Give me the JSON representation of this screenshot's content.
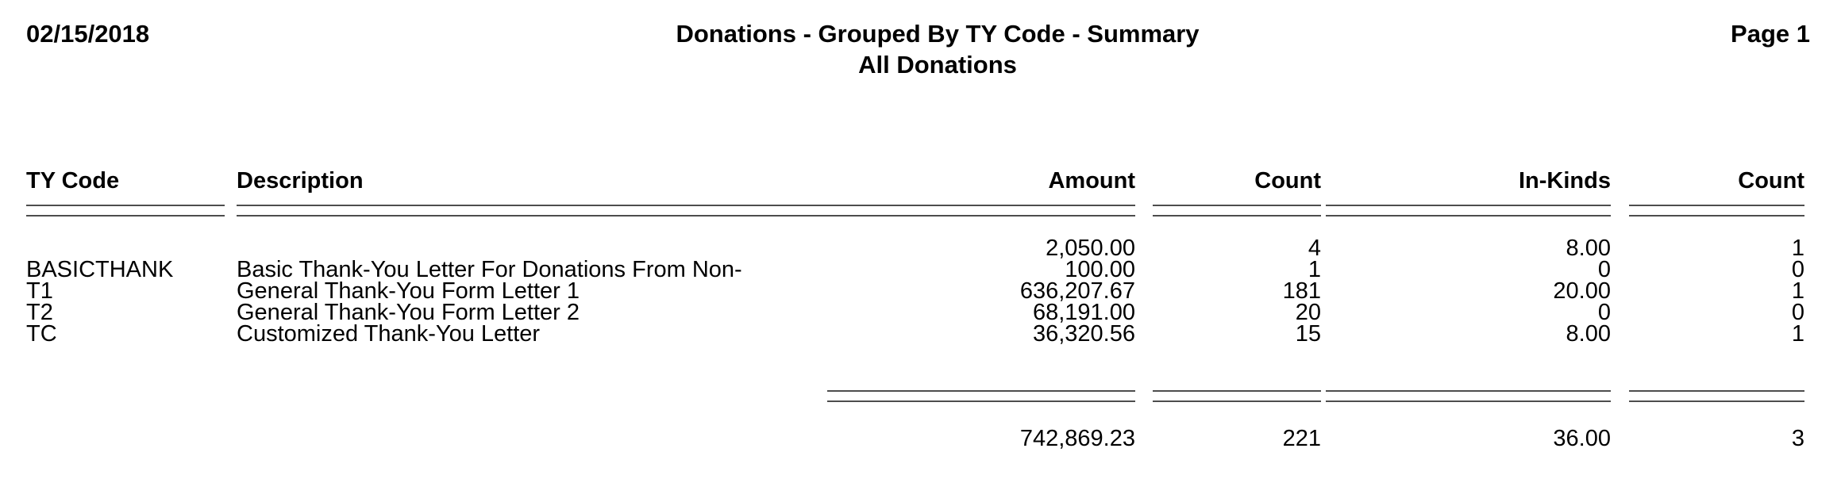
{
  "header": {
    "date": "02/15/2018",
    "title": "Donations - Grouped By TY Code - Summary",
    "subtitle": "All Donations",
    "page_label": "Page 1"
  },
  "table": {
    "columns": {
      "ty_code": "TY Code",
      "description": "Description",
      "amount": "Amount",
      "count": "Count",
      "in_kinds": "In-Kinds",
      "in_kind_count": "Count"
    },
    "rows": [
      {
        "ty_code": "",
        "description": "",
        "amount": "2,050.00",
        "count": "4",
        "in_kinds": "8.00",
        "in_kind_count": "1"
      },
      {
        "ty_code": "BASICTHANK",
        "description": "Basic Thank-You Letter For Donations From Non-",
        "amount": "100.00",
        "count": "1",
        "in_kinds": "0",
        "in_kind_count": "0"
      },
      {
        "ty_code": "T1",
        "description": "General Thank-You Form Letter 1",
        "amount": "636,207.67",
        "count": "181",
        "in_kinds": "20.00",
        "in_kind_count": "1"
      },
      {
        "ty_code": "T2",
        "description": "General Thank-You Form Letter 2",
        "amount": "68,191.00",
        "count": "20",
        "in_kinds": "0",
        "in_kind_count": "0"
      },
      {
        "ty_code": "TC",
        "description": "Customized Thank-You Letter",
        "amount": "36,320.56",
        "count": "15",
        "in_kinds": "8.00",
        "in_kind_count": "1"
      }
    ],
    "totals": {
      "ty_code": "",
      "description": "",
      "amount": "742,869.23",
      "count": "221",
      "in_kinds": "36.00",
      "in_kind_count": "3"
    }
  },
  "colors": {
    "text": "#000000",
    "rule": "#4d4d4d",
    "background": "#ffffff"
  }
}
